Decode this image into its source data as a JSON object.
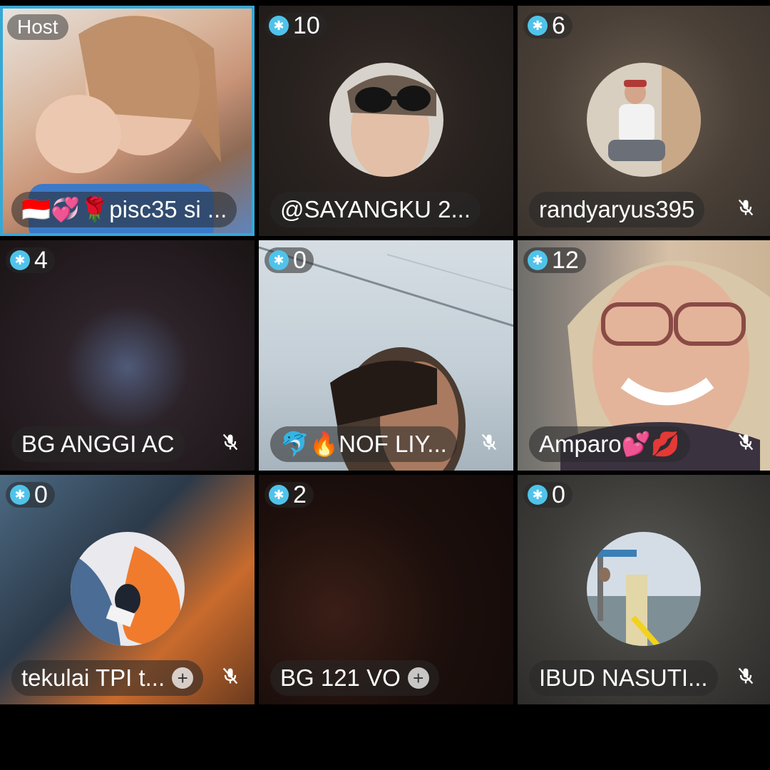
{
  "participants": [
    {
      "badge": "Host",
      "name": "🇮🇩💞🌹pisc35 si ..."
    },
    {
      "count": "10",
      "name": "@SAYANGKU 2..."
    },
    {
      "count": "6",
      "name": "randyaryus395"
    },
    {
      "count": "4",
      "name": "BG ANGGI AC"
    },
    {
      "count": "0",
      "name": "🐬🔥NOF LIY..."
    },
    {
      "count": "12",
      "name": "Amparo💕💋"
    },
    {
      "count": "0",
      "name": "tekulai TPI t..."
    },
    {
      "count": "2",
      "name": "BG 121 VO"
    },
    {
      "count": "0",
      "name": "IBUD NASUTI..."
    }
  ],
  "colors": {
    "host_border": "#35a8d6",
    "gem": "#4fc3ea",
    "background": "#000000"
  },
  "icons": {
    "gem": "gem-icon",
    "mute": "microphone-muted-icon",
    "follow": "plus-icon"
  }
}
